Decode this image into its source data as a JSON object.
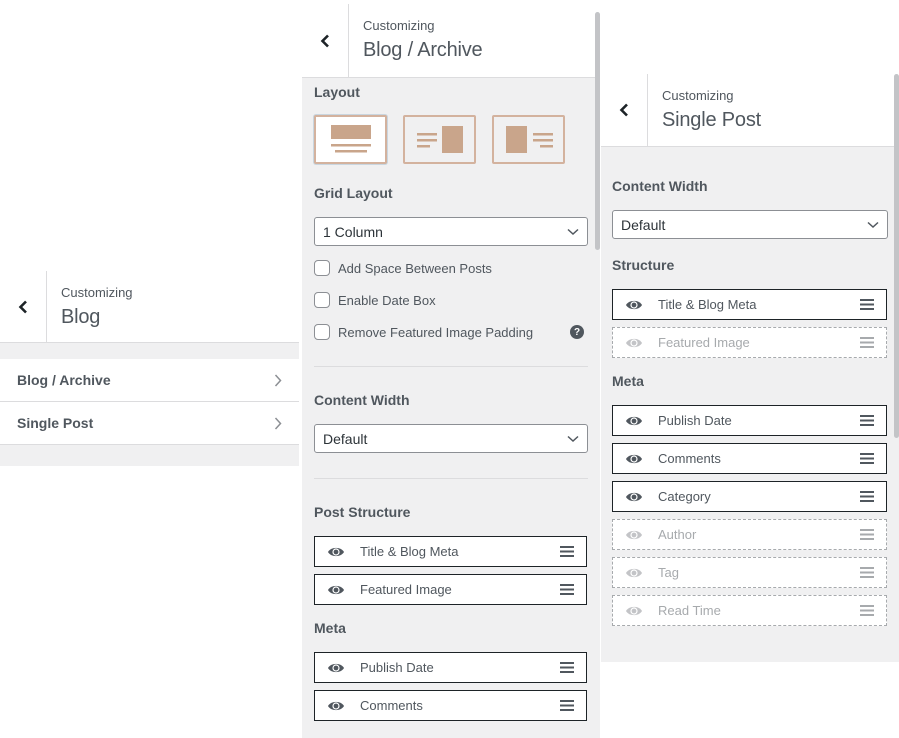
{
  "panel_blog": {
    "subtitle": "Customizing",
    "title": "Blog",
    "items": [
      {
        "label": "Blog / Archive"
      },
      {
        "label": "Single Post"
      }
    ]
  },
  "panel_archive": {
    "subtitle": "Customizing",
    "title": "Blog / Archive",
    "layout_label": "Layout",
    "layout_options": [
      "full-width",
      "sidebar-right",
      "sidebar-left"
    ],
    "layout_selected": "full-width",
    "grid_label": "Grid Layout",
    "grid_value": "1 Column",
    "checkboxes": [
      {
        "label": "Add Space Between Posts",
        "checked": false
      },
      {
        "label": "Enable Date Box",
        "checked": false
      },
      {
        "label": "Remove Featured Image Padding",
        "checked": false,
        "help": "?"
      }
    ],
    "content_width_label": "Content Width",
    "content_width_value": "Default",
    "post_structure_label": "Post Structure",
    "post_structure": [
      {
        "label": "Title & Blog Meta",
        "enabled": true
      },
      {
        "label": "Featured Image",
        "enabled": true
      }
    ],
    "meta_label": "Meta",
    "meta": [
      {
        "label": "Publish Date",
        "enabled": true
      },
      {
        "label": "Comments",
        "enabled": true
      }
    ]
  },
  "panel_single": {
    "subtitle": "Customizing",
    "title": "Single Post",
    "content_width_label": "Content Width",
    "content_width_value": "Default",
    "structure_label": "Structure",
    "structure": [
      {
        "label": "Title & Blog Meta",
        "enabled": true
      },
      {
        "label": "Featured Image",
        "enabled": false
      }
    ],
    "meta_label": "Meta",
    "meta": [
      {
        "label": "Publish Date",
        "enabled": true
      },
      {
        "label": "Comments",
        "enabled": true
      },
      {
        "label": "Category",
        "enabled": true
      },
      {
        "label": "Author",
        "enabled": false
      },
      {
        "label": "Tag",
        "enabled": false
      },
      {
        "label": "Read Time",
        "enabled": false
      }
    ]
  },
  "icons": {
    "back": "chevron-left-icon",
    "nav": "chevron-right-icon",
    "select": "chevron-down-icon",
    "visibility": "eye-icon",
    "drag": "drag-handle-icon",
    "help": "help-icon"
  },
  "colors": {
    "accent": "#d3b29e",
    "panel_bg": "#f0f0f1",
    "text": "#50575e"
  }
}
